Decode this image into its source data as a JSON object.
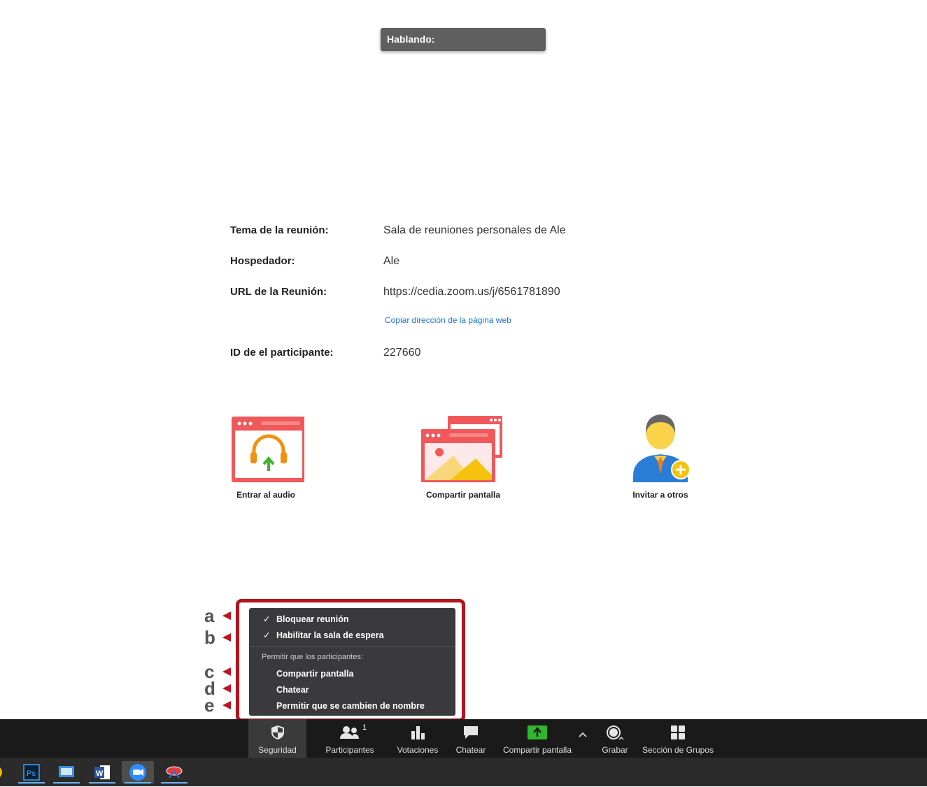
{
  "speaking_label": "Hablando:",
  "meeting_info": {
    "topic_label": "Tema de la reunión:",
    "topic_value": "Sala de reuniones personales de Ale",
    "host_label": "Hospedador:",
    "host_value": "Ale",
    "url_label": "URL de la Reunión:",
    "url_value": "https://cedia.zoom.us/j/6561781890",
    "copy_link": "Copiar dirección de la página web",
    "participant_id_label": "ID de el participante:",
    "participant_id_value": "227660"
  },
  "actions": [
    {
      "label": "Entrar al audio",
      "icon": "headphones-upload-icon"
    },
    {
      "label": "Compartir pantalla",
      "icon": "share-screen-windows-icon"
    },
    {
      "label": "Invitar a otros",
      "icon": "invite-person-icon"
    }
  ],
  "annotation_markers": [
    "a",
    "b",
    "c",
    "d",
    "e"
  ],
  "security_menu": {
    "items": [
      {
        "label": "Bloquear reunión",
        "checked": true
      },
      {
        "label": "Habilitar la sala de espera",
        "checked": true
      }
    ],
    "subheader": "Permitir que los participantes:",
    "participant_items": [
      {
        "label": "Compartir pantalla",
        "checked": false
      },
      {
        "label": "Chatear",
        "checked": false
      },
      {
        "label": "Permitir que se cambien de nombre",
        "checked": false
      }
    ]
  },
  "toolbar": {
    "security": "Seguridad",
    "participants": "Participantes",
    "participants_count": "1",
    "polls": "Votaciones",
    "chat": "Chatear",
    "share": "Compartir pantalla",
    "record": "Grabar",
    "breakout": "Sección de Grupos"
  },
  "taskbar": [
    "chrome-icon",
    "photoshop-icon",
    "control-panel-icon",
    "word-icon",
    "zoom-icon",
    "snipping-tool-icon"
  ],
  "colors": {
    "accent_red": "#b7121d",
    "link_blue": "#1a73d9",
    "share_green": "#2eb82e",
    "toolbar_bg": "#1a1a1a"
  }
}
